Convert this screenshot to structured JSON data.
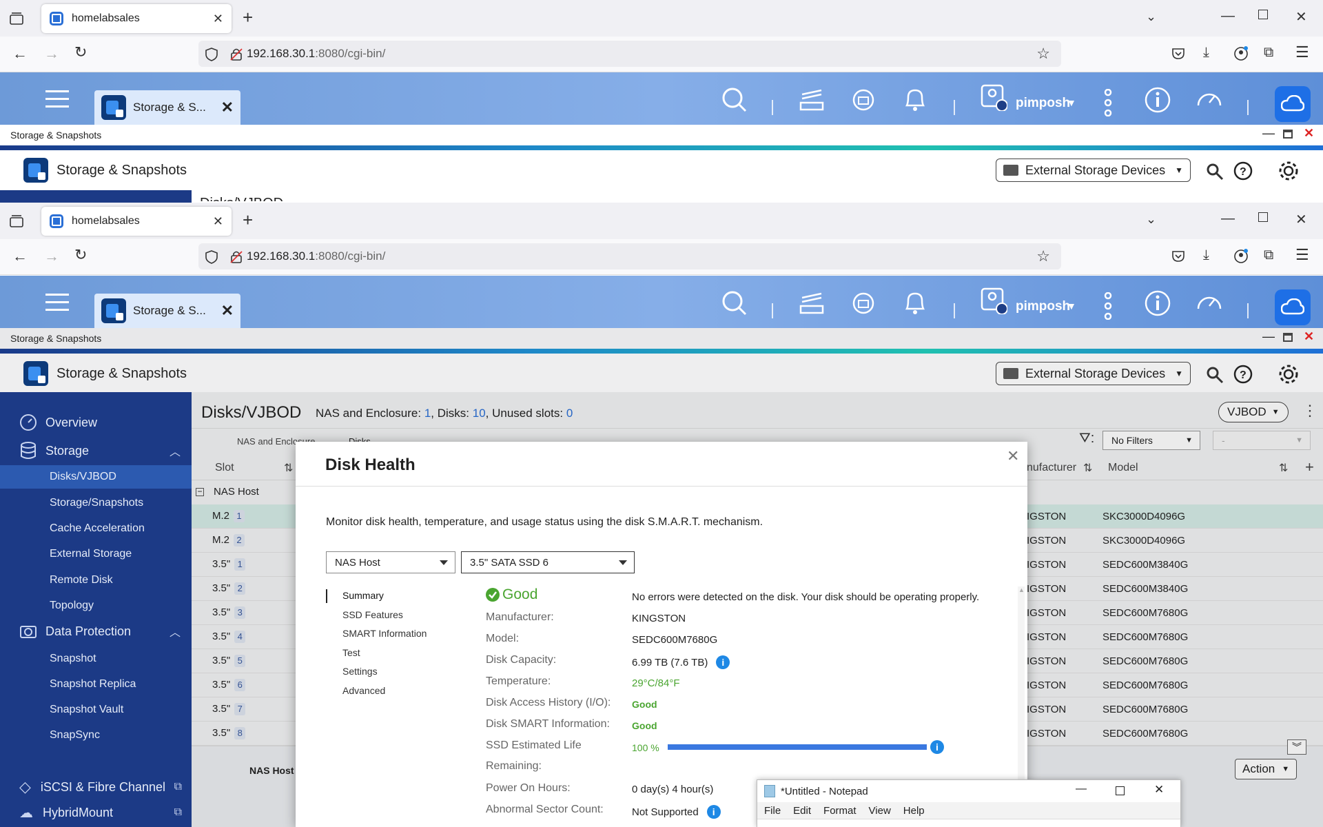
{
  "browser": {
    "tab_title": "homelabsales",
    "url_host": "192.168.30.1",
    "url_rest": ":8080/cgi-bin/"
  },
  "qts": {
    "app_tab_label": "Storage & S...",
    "user": "pimposh"
  },
  "window": {
    "title": "Storage & Snapshots",
    "app_name": "Storage & Snapshots",
    "external_storage": "External Storage Devices",
    "behind_heading": "Disks/VJBOD"
  },
  "sidebar": {
    "overview": "Overview",
    "storage": "Storage",
    "storage_items": [
      "Disks/VJBOD",
      "Storage/Snapshots",
      "Cache Acceleration",
      "External Storage",
      "Remote Disk",
      "Topology"
    ],
    "data_protection": "Data Protection",
    "dp_items": [
      "Snapshot",
      "Snapshot Replica",
      "Snapshot Vault",
      "SnapSync"
    ],
    "iscsi": "iSCSI & Fibre Channel",
    "hybridmount": "HybridMount"
  },
  "main": {
    "heading": "Disks/VJBOD",
    "summary_prefix": "NAS and Enclosure: ",
    "enclosures": "1",
    "disks_prefix": ", Disks: ",
    "disks": "10",
    "unused_prefix": ", Unused slots: ",
    "unused": "0",
    "vjbod_btn": "VJBOD",
    "tab_nas": "NAS and Enclosure",
    "tab_disks": "Disks",
    "filter": "No Filters",
    "filter2": "-",
    "col_slot": "Slot",
    "col_manufacturer": "nufacturer",
    "col_model": "Model",
    "group": "NAS Host",
    "rows": [
      {
        "slot": "M.2",
        "n": "1",
        "mfr": "IGSTON",
        "model": "SKC3000D4096G"
      },
      {
        "slot": "M.2",
        "n": "2",
        "mfr": "IGSTON",
        "model": "SKC3000D4096G"
      },
      {
        "slot": "3.5\"",
        "n": "1",
        "mfr": "IGSTON",
        "model": "SEDC600M3840G"
      },
      {
        "slot": "3.5\"",
        "n": "2",
        "mfr": "IGSTON",
        "model": "SEDC600M3840G"
      },
      {
        "slot": "3.5\"",
        "n": "3",
        "mfr": "IGSTON",
        "model": "SEDC600M7680G"
      },
      {
        "slot": "3.5\"",
        "n": "4",
        "mfr": "IGSTON",
        "model": "SEDC600M7680G"
      },
      {
        "slot": "3.5\"",
        "n": "5",
        "mfr": "IGSTON",
        "model": "SEDC600M7680G"
      },
      {
        "slot": "3.5\"",
        "n": "6",
        "mfr": "IGSTON",
        "model": "SEDC600M7680G"
      },
      {
        "slot": "3.5\"",
        "n": "7",
        "mfr": "IGSTON",
        "model": "SEDC600M7680G"
      },
      {
        "slot": "3.5\"",
        "n": "8",
        "mfr": "IGSTON",
        "model": "SEDC600M7680G"
      }
    ],
    "bottom_label": "NAS Host",
    "action_btn": "Action"
  },
  "modal": {
    "title": "Disk Health",
    "description": "Monitor disk health, temperature, and usage status using the disk S.M.A.R.T. mechanism.",
    "host_select": "NAS Host",
    "disk_select": "3.5\" SATA SSD 6",
    "nav": [
      "Summary",
      "SSD Features",
      "SMART Information",
      "Test",
      "Settings",
      "Advanced"
    ],
    "status": "Good",
    "status_message": "No errors were detected on the disk. Your disk should be operating properly.",
    "fields": {
      "manufacturer_label": "Manufacturer:",
      "manufacturer": "KINGSTON",
      "model_label": "Model:",
      "model": "SEDC600M7680G",
      "capacity_label": "Disk Capacity:",
      "capacity": "6.99 TB (7.6 TB)",
      "temperature_label": "Temperature:",
      "temperature": "29°C/84°F",
      "access_label": "Disk Access History (I/O):",
      "access": "Good",
      "smart_label": "Disk SMART Information:",
      "smart": "Good",
      "life_label_1": "SSD Estimated Life",
      "life_label_2": "Remaining:",
      "life": "100 %",
      "life_fraction": 1.0,
      "power_label": "Power On Hours:",
      "power": "0 day(s) 4 hour(s)",
      "abnormal_label": "Abnormal Sector Count:",
      "abnormal": "Not Supported"
    }
  },
  "notepad": {
    "title": "*Untitled - Notepad",
    "menu": [
      "File",
      "Edit",
      "Format",
      "View",
      "Help"
    ]
  },
  "colors": {
    "accent": "#1e6fe6",
    "sidebar": "#1c3a86",
    "good": "#4aa530",
    "progress": "#3a78e0"
  }
}
